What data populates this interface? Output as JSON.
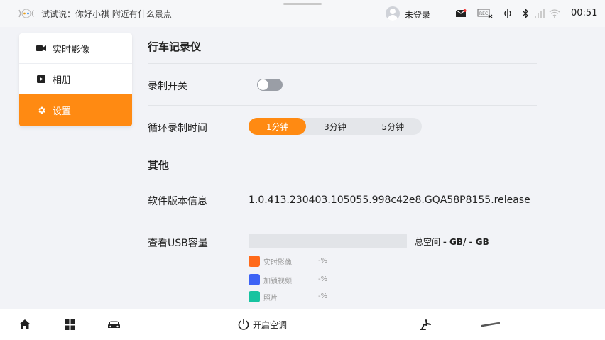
{
  "status_bar": {
    "voice_hint": "试试说：你好小祺 附近有什么景点",
    "login_status": "未登录",
    "time": "00:51"
  },
  "sidebar": {
    "items": [
      {
        "label": "实时影像",
        "icon": "video-camera-icon",
        "active": false
      },
      {
        "label": "相册",
        "icon": "play-album-icon",
        "active": false
      },
      {
        "label": "设置",
        "icon": "gear-icon",
        "active": true
      }
    ]
  },
  "main": {
    "section_dashcam": "行车记录仪",
    "record_switch": {
      "label": "录制开关",
      "on": false
    },
    "loop_record": {
      "label": "循环录制时间",
      "options": [
        "1分钟",
        "3分钟",
        "5分钟"
      ],
      "selected": "1分钟"
    },
    "section_other": "其他",
    "version": {
      "label": "软件版本信息",
      "value": "1.0.413.230403.105055.998c42e8.GQA58P8155.release"
    },
    "usb": {
      "label": "查看USB容量",
      "total_prefix": "总空间",
      "total_value": "- GB/ - GB",
      "legend": [
        {
          "label": "实时影像",
          "value": "-%",
          "color": "#ff6a1a"
        },
        {
          "label": "加锁视频",
          "value": "-%",
          "color": "#3d63f5"
        },
        {
          "label": "照片",
          "value": "-%",
          "color": "#17c3a0"
        }
      ]
    }
  },
  "dock": {
    "ac_label": "开启空调",
    "icons": [
      "home-icon",
      "apps-grid-icon",
      "car-icon",
      "seat-icon"
    ]
  },
  "colors": {
    "accent": "#ff8a12",
    "background": "#f2f3f7"
  }
}
